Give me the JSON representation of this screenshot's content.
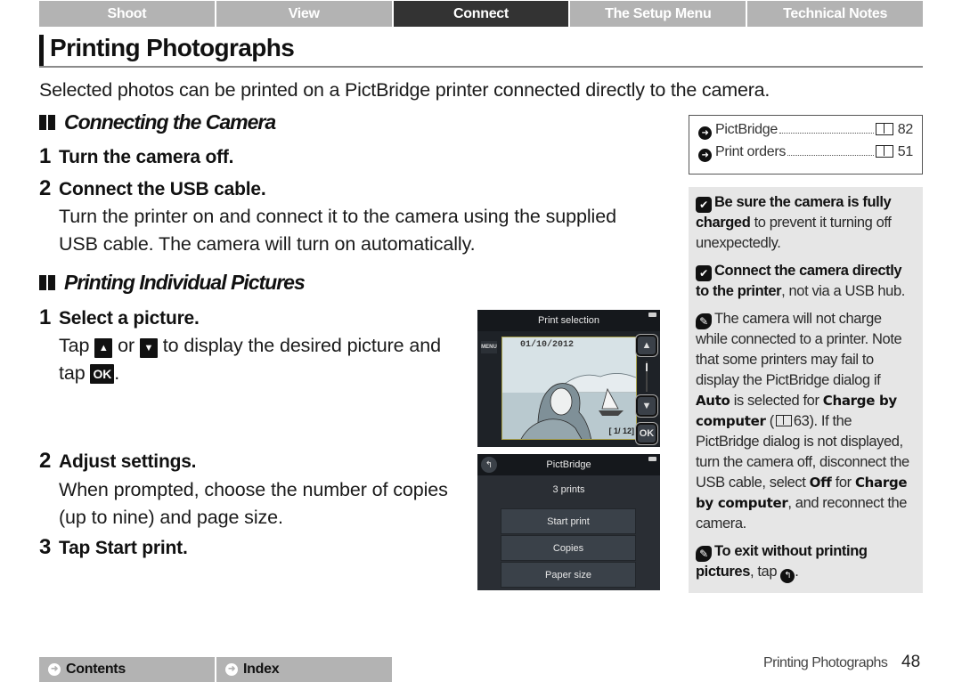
{
  "nav": {
    "tabs": [
      {
        "label": "Shoot",
        "active": false
      },
      {
        "label": "View",
        "active": false
      },
      {
        "label": "Connect",
        "active": true
      },
      {
        "label": "The Setup Menu",
        "active": false
      },
      {
        "label": "Technical Notes",
        "active": false
      }
    ]
  },
  "page": {
    "title": "Printing Photographs",
    "intro": "Selected photos can be printed on a PictBridge printer connected directly to the camera."
  },
  "sections": [
    {
      "heading": "Connecting the Camera",
      "steps": [
        {
          "num": "1",
          "head": "Turn the camera off."
        },
        {
          "num": "2",
          "head": "Connect the USB cable.",
          "body": "Turn the printer on and connect it to the camera using the supplied USB cable. The camera will turn on automatically."
        }
      ]
    },
    {
      "heading": "Printing Individual Pictures",
      "steps": [
        {
          "num": "1",
          "head": "Select a picture.",
          "body_parts": [
            "Tap",
            "or",
            "to display the desired picture and tap",
            "."
          ],
          "keys": {
            "up": "▲",
            "down": "▼",
            "ok": "OK"
          }
        },
        {
          "num": "2",
          "head": "Adjust settings.",
          "body": "When prompted, choose the number of copies (up to nine) and page size."
        },
        {
          "num": "3",
          "head_prefix": "Tap",
          "head_bold": "Start print."
        }
      ]
    }
  ],
  "screens": {
    "print_selection": {
      "title": "Print selection",
      "menu_label": "MENU",
      "date": "01/10/2012",
      "counter": "[ 1/ 12]",
      "up_icon": "▲",
      "down_icon": "▼",
      "ok_label": "OK"
    },
    "pictbridge": {
      "title": "PictBridge",
      "back_icon": "↰",
      "prints": "3 prints",
      "options": [
        "Start print",
        "Copies",
        "Paper size"
      ]
    }
  },
  "sidebar": {
    "xrefs": [
      {
        "label": "PictBridge",
        "page": "82"
      },
      {
        "label": "Print orders",
        "page": "51"
      }
    ],
    "notes": {
      "n1_bold": "Be sure the camera is fully charged",
      "n1_rest": " to prevent it turning off unexpectedly.",
      "n2_bold": "Connect the camera directly to the printer",
      "n2_rest": ", not via a USB hub.",
      "n3_a": "The camera will not charge while connected to a printer. Note that some printers may fail to display the PictBridge dialog if ",
      "n3_auto": "Auto",
      "n3_b": " is selected for ",
      "n3_charge": "Charge by computer",
      "n3_c": " (",
      "n3_page": "63",
      "n3_d": "). If the PictBridge dialog is not displayed, turn the camera off, disconnect the USB cable, select ",
      "n3_off": "Off",
      "n3_e": " for ",
      "n3_charge2": "Charge by computer",
      "n3_f": ", and reconnect the camera.",
      "n4_bold": "To exit without printing pictures",
      "n4_rest": ", tap",
      "n4_end": "."
    }
  },
  "footer": {
    "contents": "Contents",
    "index": "Index",
    "section_label": "Printing Photographs",
    "page_number": "48"
  }
}
